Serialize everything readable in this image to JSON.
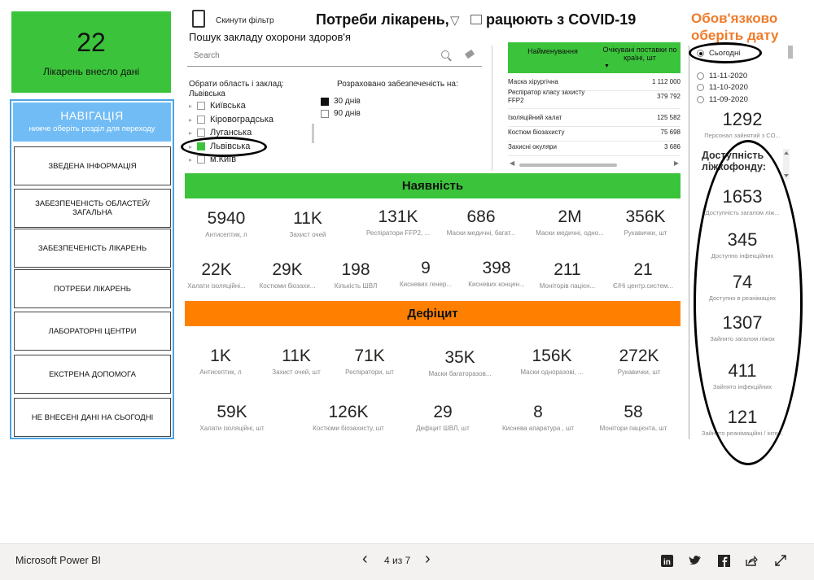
{
  "kpi_top": {
    "value": "22",
    "label": "Лікарень внесло дані"
  },
  "nav": {
    "title": "НАВІГАЦІЯ",
    "subtitle": "нижче оберіть розділ для переходу",
    "items": [
      "ЗВЕДЕНА ІНФОРМАЦІЯ",
      "ЗАБЕЗПЕЧЕНІСТЬ ОБЛАСТЕЙ/ ЗАГАЛЬНА",
      "ЗАБЕЗПЕЧЕНІСТЬ ЛІКАРЕНЬ",
      "ПОТРЕБИ ЛІКАРЕНЬ",
      "ЛАБОРАТОРНІ ЦЕНТРИ",
      "ЕКСТРЕНА ДОПОМОГА",
      "НЕ ВНЕСЕНІ ДАНІ НА СЬОГОДНІ"
    ]
  },
  "header": {
    "reset_label": "Скинути фільтр",
    "title": "Потреби лікарень, які працюють з COVID-19"
  },
  "search": {
    "label": "Пошук закладу охорони здоров'я",
    "placeholder": "Search"
  },
  "region_slicer": {
    "label": "Обрати область і заклад:",
    "selected": "Львівська",
    "items": [
      {
        "name": "Київська",
        "checked": false
      },
      {
        "name": "Кіровоградська",
        "checked": false
      },
      {
        "name": "Луганська",
        "checked": false
      },
      {
        "name": "Львівська",
        "checked": true
      },
      {
        "name": "м.Київ",
        "checked": false
      }
    ]
  },
  "calc_slicer": {
    "label": "Розраховано забезпеченість на:",
    "items": [
      {
        "name": "30 днів",
        "checked": true
      },
      {
        "name": "90 днів",
        "checked": false
      }
    ]
  },
  "table": {
    "col1": "Найменування",
    "col2": "Очікувані поставки по країні, шт",
    "rows": [
      {
        "name": "Маска хірургічна",
        "value": "1 112 000"
      },
      {
        "name": "Респіратор класу захисту FFP2",
        "value": "379 792"
      },
      {
        "name": "Ізоляційний халат",
        "value": "125 582"
      },
      {
        "name": "Костюм біозахисту",
        "value": "75 698"
      },
      {
        "name": "Захисні окуляри",
        "value": "3 686"
      }
    ]
  },
  "availability": {
    "title": "Наявність",
    "row1": [
      {
        "value": "5940",
        "label": "Антисептик, л"
      },
      {
        "value": "11K",
        "label": "Захист очей"
      },
      {
        "value": "131K",
        "label": "Респіратори FFP2, ..."
      },
      {
        "value": "686",
        "label": "Маски медичні, багат..."
      },
      {
        "value": "2M",
        "label": "Маски медичні, одно..."
      },
      {
        "value": "356K",
        "label": "Рукавички, шт"
      }
    ],
    "row2": [
      {
        "value": "22K",
        "label": "Халати ізоляційні..."
      },
      {
        "value": "29K",
        "label": "Костюми біозахи..."
      },
      {
        "value": "198",
        "label": "Кількість ШВЛ"
      },
      {
        "value": "9",
        "label": "Кисневих генер..."
      },
      {
        "value": "398",
        "label": "Кисневих концен..."
      },
      {
        "value": "211",
        "label": "Моніторів пацієн..."
      },
      {
        "value": "21",
        "label": "Є/Ні центр.систем..."
      }
    ]
  },
  "deficit": {
    "title": "Дефіцит",
    "row1": [
      {
        "value": "1K",
        "label": "Антисептик, л"
      },
      {
        "value": "11K",
        "label": "Захист очей, шт"
      },
      {
        "value": "71K",
        "label": "Респіратори, шт"
      },
      {
        "value": "35K",
        "label": "Маски багаторазов..."
      },
      {
        "value": "156K",
        "label": "Маски одноразові, ..."
      },
      {
        "value": "272K",
        "label": "Рукавички, шт"
      }
    ],
    "row2": [
      {
        "value": "59K",
        "label": "Халати ізоляційні, шт"
      },
      {
        "value": "126K",
        "label": "Костюми біозахисту, шт"
      },
      {
        "value": "29",
        "label": "Дефіцит ШВЛ, шт"
      },
      {
        "value": "8",
        "label": "Киснева апаратура , шт"
      },
      {
        "value": "58",
        "label": "Монітори пацієнта, шт"
      }
    ]
  },
  "date_slicer": {
    "title_line1": "Обов'язково",
    "title_line2": "оберіть дату",
    "items": [
      {
        "name": "Сьогодні",
        "checked": true
      },
      {
        "name": "11-11-2020",
        "checked": false
      },
      {
        "name": "11-10-2020",
        "checked": false
      },
      {
        "name": "11-09-2020",
        "checked": false
      }
    ]
  },
  "right_cards": {
    "personnel": {
      "value": "1292",
      "label": "Персонал зайнятий з CO..."
    },
    "bed_title_line1": "Доступність",
    "bed_title_line2": "ліжкофонду:",
    "items": [
      {
        "value": "1653",
        "label": "Доступність загалом ліж..."
      },
      {
        "value": "345",
        "label": "Доступно інфекційних"
      },
      {
        "value": "74",
        "label": "Доступно в реанімаціях"
      },
      {
        "value": "1307",
        "label": "Зайнято загалом ліжок"
      },
      {
        "value": "411",
        "label": "Зайнято інфекційних"
      },
      {
        "value": "121",
        "label": "Зайнято реанімаційні / інте..."
      }
    ]
  },
  "footer": {
    "brand": "Microsoft Power BI",
    "page": "4 из 7"
  }
}
